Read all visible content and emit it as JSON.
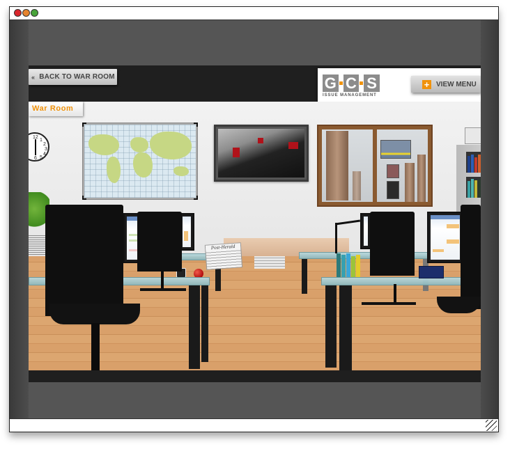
{
  "window": {
    "controls": [
      {
        "name": "close",
        "color": "#d9262c"
      },
      {
        "name": "minimize",
        "color": "#e6842e"
      },
      {
        "name": "zoom",
        "color": "#48a43a"
      }
    ]
  },
  "header": {
    "back_button": {
      "icon": "double-chevron-left",
      "icon_glyph": "«",
      "label": "BACK TO WAR ROOM"
    },
    "logo": {
      "letters": [
        "G",
        "C",
        "S"
      ],
      "subtitle": "ISSUE MANAGEMENT",
      "letter_color": "#8c8c8c",
      "dot_color": "#f0920b"
    },
    "view_menu_button": {
      "icon": "plus",
      "icon_glyph": "+",
      "label": "VIEW MENU"
    }
  },
  "scene": {
    "room_label": "War Room",
    "accent_color": "#f0920b",
    "clock_numbers": [
      "12",
      "1",
      "2",
      "3",
      "4",
      "5",
      "6"
    ],
    "newspaper_title": "Post-Herald",
    "objects": [
      "wall-clock",
      "world-map",
      "abstract-artwork",
      "window-city-view",
      "billboard",
      "stereo-receiver",
      "bookshelf",
      "plant",
      "paper-stack",
      "office-chair",
      "desk",
      "computer-monitor",
      "newspaper",
      "apple",
      "coffee-mug",
      "desk-lamp",
      "binders",
      "document-tray"
    ]
  }
}
